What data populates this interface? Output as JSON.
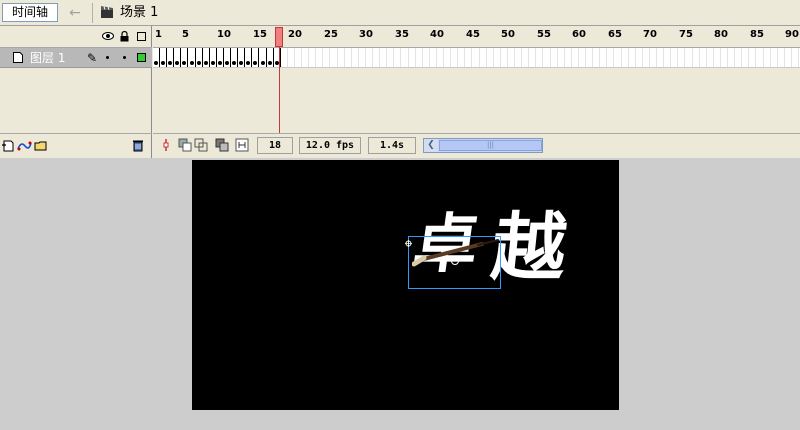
{
  "topbar": {
    "timeline_tab": "时间轴",
    "back_icon": "arrow-left-icon",
    "scene_icon": "scene-clapper-icon",
    "scene_label": "场景 1"
  },
  "layers": {
    "header_icons": [
      "eye-icon",
      "lock-icon",
      "outline-icon"
    ],
    "rows": [
      {
        "name": "图层 1",
        "editing": true,
        "visible": true,
        "locked": false,
        "outline_color": "#33cc33"
      }
    ],
    "tools": [
      "add-layer-icon",
      "add-guide-layer-icon",
      "add-folder-icon",
      "trash-icon"
    ]
  },
  "timeline": {
    "ruler_labels": [
      "1",
      "5",
      "10",
      "15",
      "20",
      "25",
      "30",
      "35",
      "40",
      "45",
      "50",
      "55",
      "60",
      "65",
      "70",
      "75",
      "80",
      "85",
      "90"
    ],
    "keyframe_count": 18,
    "current_frame": "18",
    "frame_rate": "12.0 fps",
    "elapsed_time": "1.4s",
    "playhead_color": "#cc3333"
  },
  "frame_tools": [
    "center-frame-icon",
    "onion-skin-icon",
    "onion-skin-outline-icon",
    "edit-multiple-frames-icon",
    "modify-onion-markers-icon"
  ],
  "stage": {
    "background": "#000000",
    "characters": [
      "卓",
      "越"
    ]
  },
  "colors": {
    "panel_bg": "#ece9d8",
    "layer_selected_bg": "#b8b8b8",
    "stage_bg": "#000000",
    "workspace_bg": "#cdcdcd",
    "selection": "#3399ff"
  }
}
